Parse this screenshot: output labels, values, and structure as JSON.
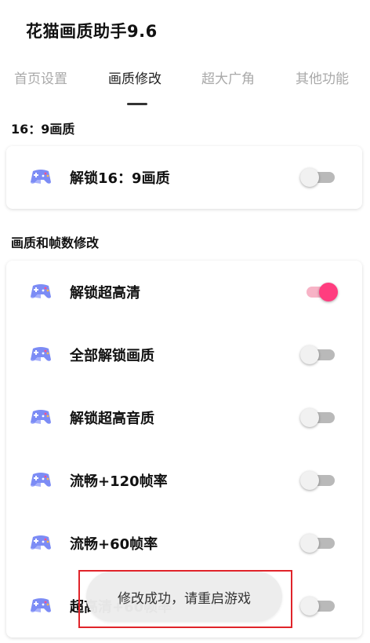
{
  "app": {
    "title": "花猫画质助手9.6"
  },
  "tabs": [
    {
      "label": "首页设置",
      "active": false
    },
    {
      "label": "画质修改",
      "active": true
    },
    {
      "label": "超大广角",
      "active": false
    },
    {
      "label": "其他功能",
      "active": false
    }
  ],
  "sections": [
    {
      "title": "16：9画质",
      "items": [
        {
          "label": "解锁16：9画质",
          "enabled": false,
          "icon": "gamepad-icon"
        }
      ]
    },
    {
      "title": "画质和帧数修改",
      "items": [
        {
          "label": "解锁超高清",
          "enabled": true,
          "icon": "gamepad-icon"
        },
        {
          "label": "全部解锁画质",
          "enabled": false,
          "icon": "gamepad-icon"
        },
        {
          "label": "解锁超高音质",
          "enabled": false,
          "icon": "gamepad-icon"
        },
        {
          "label": "流畅+120帧率",
          "enabled": false,
          "icon": "gamepad-icon"
        },
        {
          "label": "流畅+60帧率",
          "enabled": false,
          "icon": "gamepad-icon"
        },
        {
          "label": "超高清+60帧率",
          "enabled": false,
          "icon": "gamepad-icon"
        }
      ]
    }
  ],
  "toast": {
    "message": "修改成功，请重启游戏"
  },
  "colors": {
    "accent": "#ff3d7f",
    "accent_track": "#f7b3c6",
    "off_track": "#b9b9b9",
    "highlight": "#e0242a"
  }
}
